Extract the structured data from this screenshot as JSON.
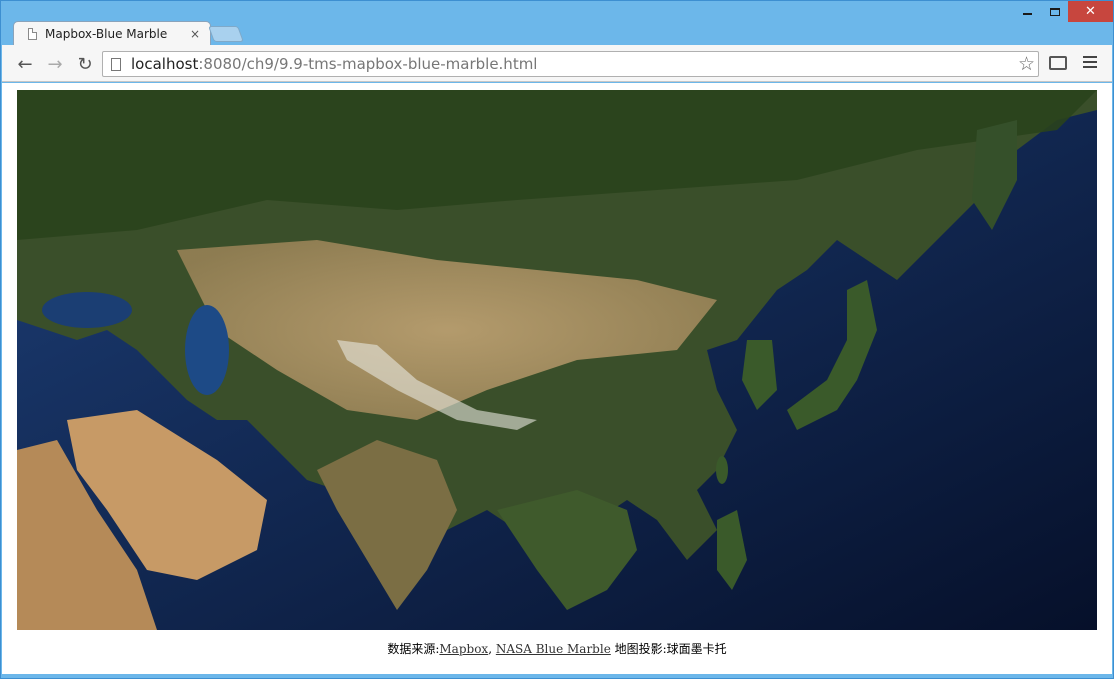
{
  "browser": {
    "tab_title": "Mapbox-Blue Marble",
    "tab_close": "×",
    "url_host": "localhost",
    "url_rest": ":8080/ch9/9.9-tms-mapbox-blue-marble.html",
    "close_glyph": "✕"
  },
  "icons": {
    "back": "←",
    "forward": "→",
    "reload": "↻",
    "star": "☆"
  },
  "caption": {
    "prefix": "数据来源:",
    "link1": "Mapbox",
    "sep": ", ",
    "link2": "NASA Blue Marble",
    "suffix": " 地图投影:球面墨卡托"
  },
  "colors": {
    "ocean": "#0b1a3a",
    "land_green": "#2f4a22",
    "desert": "#c2a073",
    "titlebar": "#6cb7ea"
  }
}
